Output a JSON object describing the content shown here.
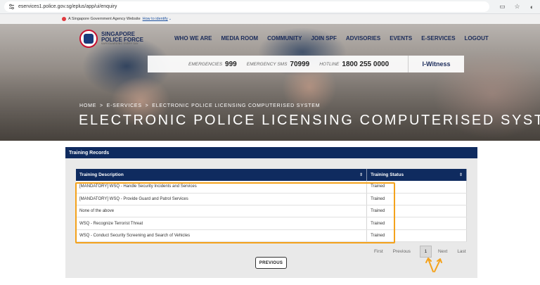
{
  "browser": {
    "url": "eservices1.police.gov.sg/eplus/app/ui/enquiry"
  },
  "gov_banner": {
    "text": "A Singapore Government Agency Website",
    "link": "How to identify"
  },
  "logo": {
    "line1": "SINGAPORE",
    "line2": "POLICE FORCE",
    "tagline": "SAFEGUARDING EVERY DAY"
  },
  "nav": {
    "items": [
      "WHO WE ARE",
      "MEDIA ROOM",
      "COMMUNITY",
      "JOIN SPF",
      "ADVISORIES",
      "EVENTS",
      "E-SERVICES",
      "LOGOUT"
    ]
  },
  "hotlines": {
    "emergencies_label": "EMERGENCIES",
    "emergencies_num": "999",
    "sms_label": "EMERGENCY SMS",
    "sms_num": "70999",
    "hotline_label": "HOTLINE",
    "hotline_num": "1800 255 0000",
    "iwitness": "I-Witness"
  },
  "breadcrumb": {
    "home": "HOME",
    "sep": ">",
    "eservices": "E-SERVICES",
    "current": "ELECTRONIC POLICE LICENSING COMPUTERISED SYSTEM"
  },
  "page_title": "ELECTRONIC POLICE LICENSING COMPUTERISED SYSTEM",
  "panel": {
    "title": "Training Records"
  },
  "table": {
    "headers": [
      "Training Description",
      "Training Status"
    ],
    "rows": [
      [
        "[MANDATORY] WSQ - Handle Security Incidents and Services",
        "Trained"
      ],
      [
        "[MANDATORY] WSQ - Provide Guard and Patrol Services",
        "Trained"
      ],
      [
        "None of the above",
        "Trained"
      ],
      [
        "WSQ - Recognize Terrorist Threat",
        "Trained"
      ],
      [
        "WSQ - Conduct Security Screening and Search of Vehicles",
        "Trained"
      ]
    ]
  },
  "pagination": {
    "first": "First",
    "previous": "Previous",
    "current": "1",
    "next": "Next",
    "last": "Last"
  },
  "buttons": {
    "previous": "PREVIOUS"
  },
  "colors": {
    "navy": "#0f2b5f",
    "highlight": "#f4a21b",
    "brand_red": "#c8102e"
  }
}
